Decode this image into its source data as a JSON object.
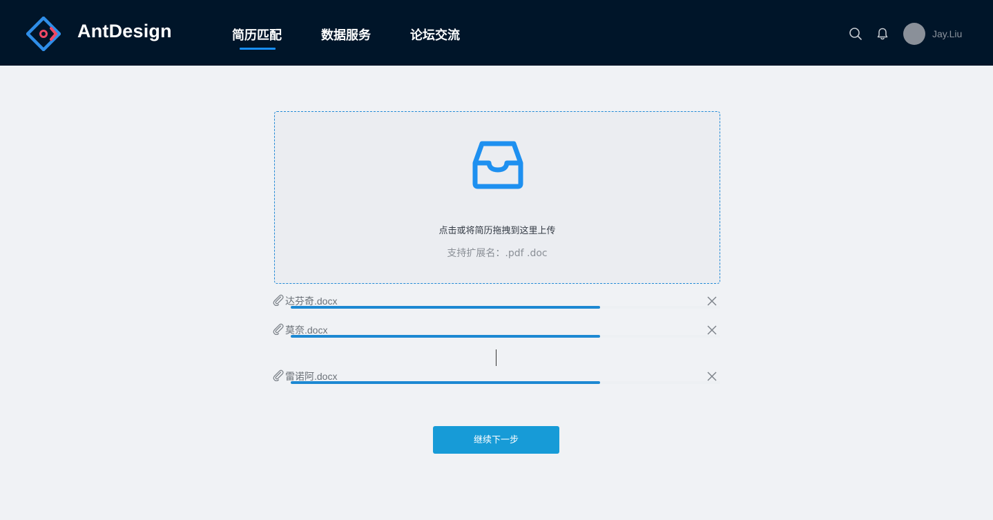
{
  "header": {
    "brand": "AntDesign",
    "nav": [
      {
        "label": "简历匹配",
        "active": true
      },
      {
        "label": "数据服务",
        "active": false
      },
      {
        "label": "论坛交流",
        "active": false
      }
    ],
    "user_name": "Jay.Liu",
    "icons": [
      "search-icon",
      "bell-icon"
    ]
  },
  "upload": {
    "title": "点击或将简历拖拽到这里上传",
    "hint": "支持扩展名：.pdf .doc",
    "icon": "inbox-icon"
  },
  "files": [
    {
      "name": "达芬奇.docx",
      "progress": 0.72
    },
    {
      "name": "莫奈.docx",
      "progress": 0.72
    },
    {
      "name": "雷诺阿.docx",
      "progress": 0.72
    }
  ],
  "next_button": "继续下一步",
  "colors": {
    "header_bg": "#001529",
    "accent": "#1890ff",
    "button": "#179bd7",
    "page_bg": "#f0f2f5"
  }
}
